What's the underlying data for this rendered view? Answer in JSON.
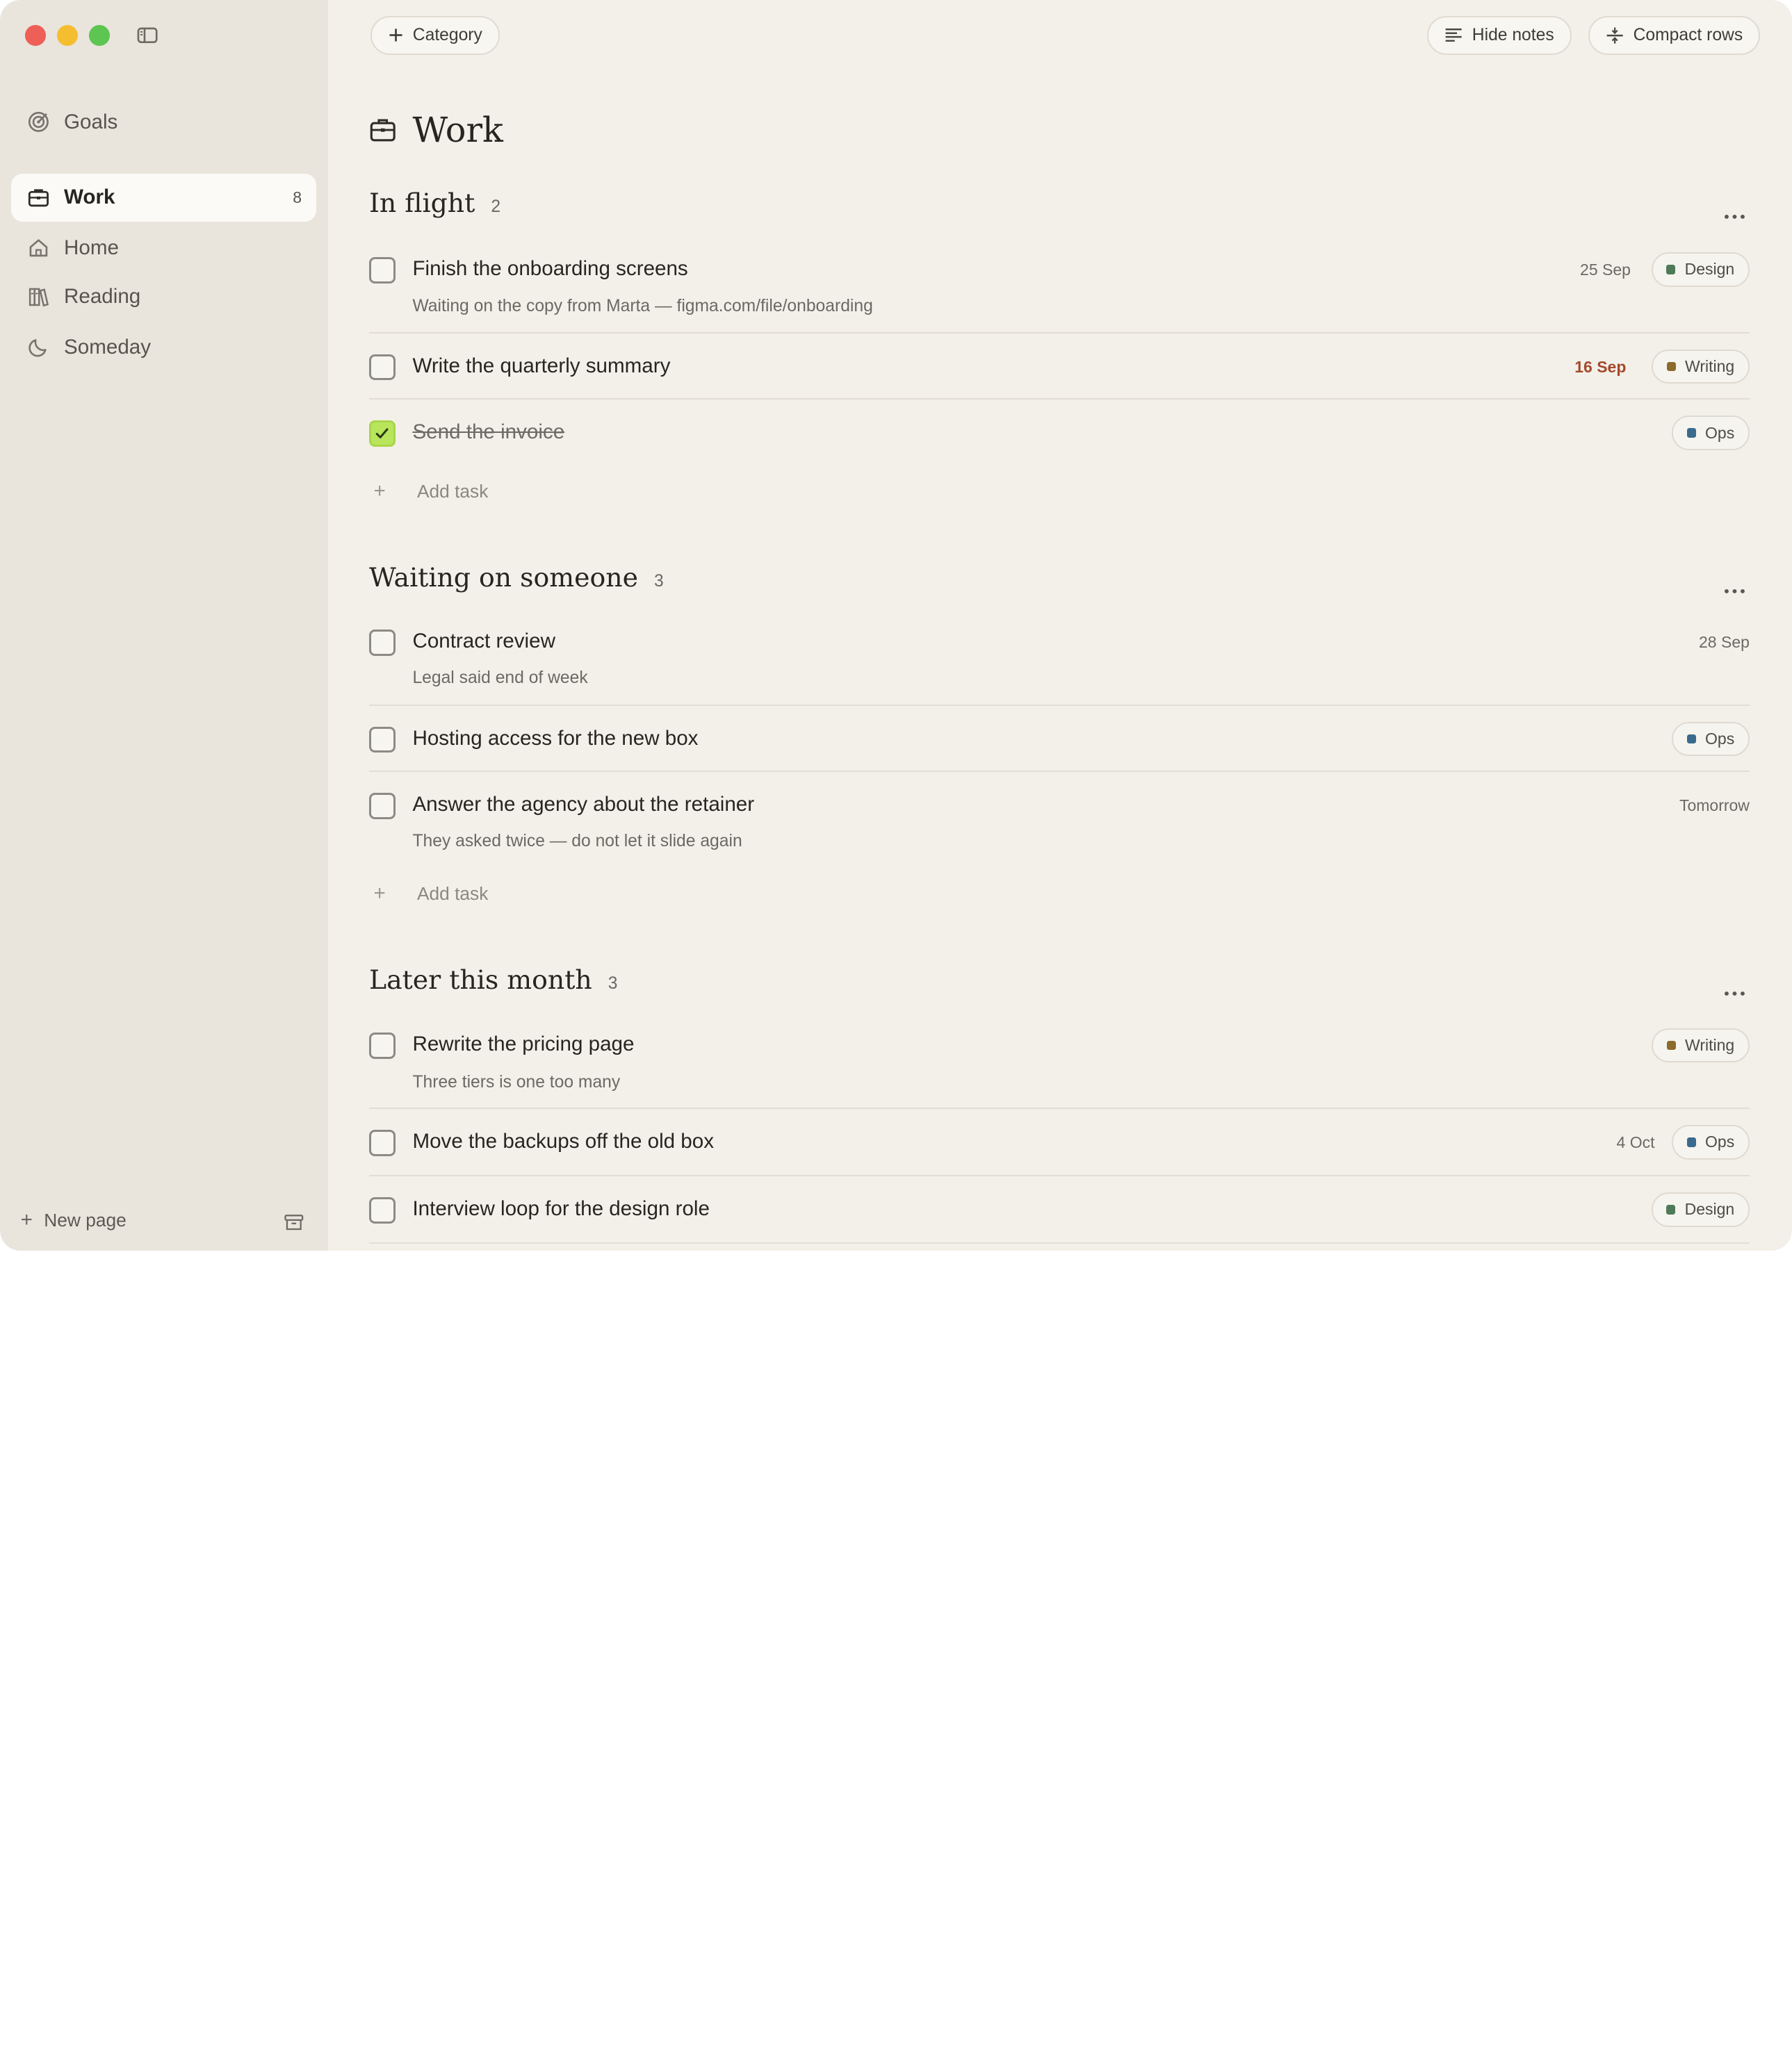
{
  "sidebar": {
    "items": [
      {
        "label": "Goals",
        "icon": "target-icon"
      },
      {
        "label": "Work",
        "icon": "briefcase-icon",
        "count": "8",
        "active": true
      },
      {
        "label": "Home",
        "icon": "house-icon"
      },
      {
        "label": "Reading",
        "icon": "books-icon"
      },
      {
        "label": "Someday",
        "icon": "moon-icon"
      }
    ],
    "new_page": "New page"
  },
  "toolbar": {
    "category": "Category",
    "hide_notes": "Hide notes",
    "compact_rows": "Compact rows"
  },
  "page": {
    "title": "Work"
  },
  "colors": {
    "Design": "#4e7a5a",
    "Writing": "#8c6a2c",
    "Ops": "#3a6a8e"
  },
  "sections": [
    {
      "title": "In flight",
      "count": "2",
      "tasks": [
        {
          "title": "Finish the onboarding screens",
          "note": "Waiting on the copy from Marta — figma.com/file/onboarding",
          "date": "25 Sep",
          "tag": "Design"
        },
        {
          "title": "Write the quarterly summary",
          "date": "16 Sep",
          "overdue": true,
          "tag": "Writing"
        },
        {
          "title": "Send the invoice",
          "done": true,
          "tag": "Ops"
        }
      ],
      "add": "Add task"
    },
    {
      "title": "Waiting on someone",
      "count": "3",
      "tasks": [
        {
          "title": "Contract review",
          "note": "Legal said end of week",
          "date": "28 Sep"
        },
        {
          "title": "Hosting access for the new box",
          "tag": "Ops"
        },
        {
          "title": "Answer the agency about the retainer",
          "note": "They asked twice — do not let it slide again",
          "date": "Tomorrow"
        }
      ],
      "add": "Add task"
    },
    {
      "title": "Later this month",
      "count": "3",
      "tasks": [
        {
          "title": "Rewrite the pricing page",
          "note": "Three tiers is one too many",
          "tag": "Writing"
        },
        {
          "title": "Move the backups off the old box",
          "date": "4 Oct",
          "tag": "Ops"
        },
        {
          "title": "Interview loop for the design role",
          "tag": "Design"
        }
      ]
    }
  ]
}
